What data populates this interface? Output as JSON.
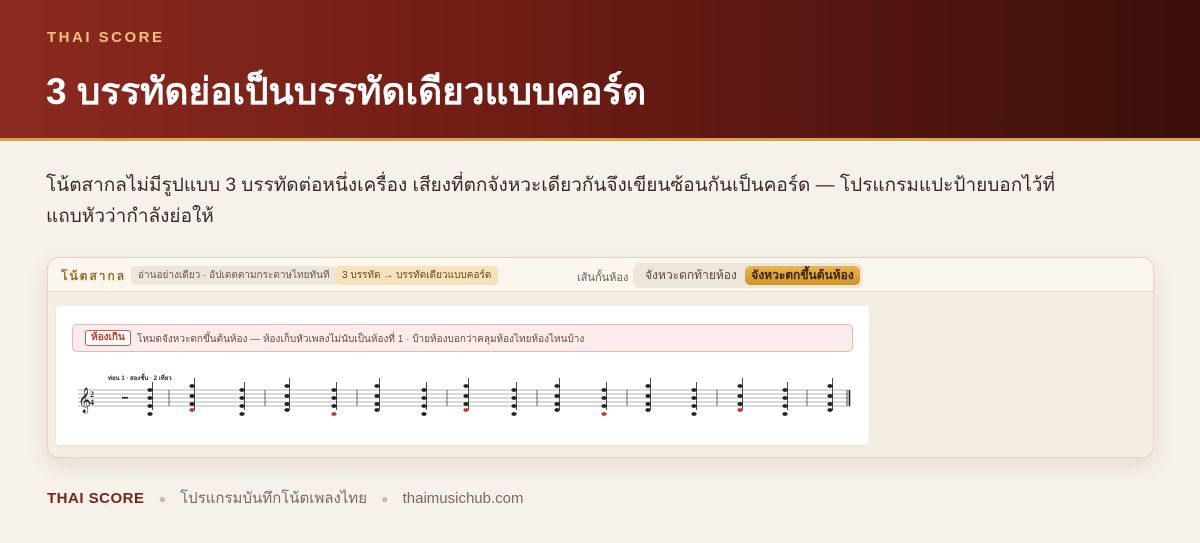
{
  "header": {
    "eyebrow": "THAI SCORE",
    "title": "3 บรรทัดย่อเป็นบรรทัดเดียวแบบคอร์ด"
  },
  "description": "โน้ตสากลไม่มีรูปแบบ 3 บรรทัดต่อหนึ่งเครื่อง เสียงที่ตกจังหวะเดียวกันจึงเขียนซ้อนกันเป็นคอร์ด — โปรแกรมแปะป้ายบอกไว้ที่แถบหัวว่ากำลังย่อให้",
  "toolbar": {
    "title": "โน้ตสากล",
    "readonly_pill": "อ่านอย่างเดียว · อัปเดตตามกระดาษไทยทันที",
    "mode_pill": "3 บรรทัด → บรรทัดเดียวแบบคอร์ด",
    "barline_label": "เส้นกั้นห้อง",
    "barline_options": [
      "จังหวะตกท้ายห้อง",
      "จังหวะตกขึ้นต้นห้อง"
    ],
    "barline_selected": "จังหวะตกขึ้นต้นห้อง"
  },
  "score": {
    "alert_badge": "ห้องเกิน",
    "alert_text": "โหมดจังหวะตกขึ้นต้นห้อง — ห้องเก็บหัวเพลงไม่นับเป็นห้องที่ 1 · ป้ายห้องบอกว่าคลุมห้องไทยห้องไหนบ้าง",
    "section_label": "ท่อน 1 · สองชั้น · 2 เที่ยว",
    "time_signature": [
      "2",
      "4"
    ]
  },
  "footer": {
    "brand": "THAI SCORE",
    "tagline": "โปรแกรมบันทึกโน้ตเพลงไทย",
    "site": "thaimusichub.com"
  },
  "colors": {
    "header_start": "#8c2a1f",
    "header_end": "#3a0f0a",
    "accent_gold": "#d8a24a",
    "alert_red": "#c0392b"
  }
}
